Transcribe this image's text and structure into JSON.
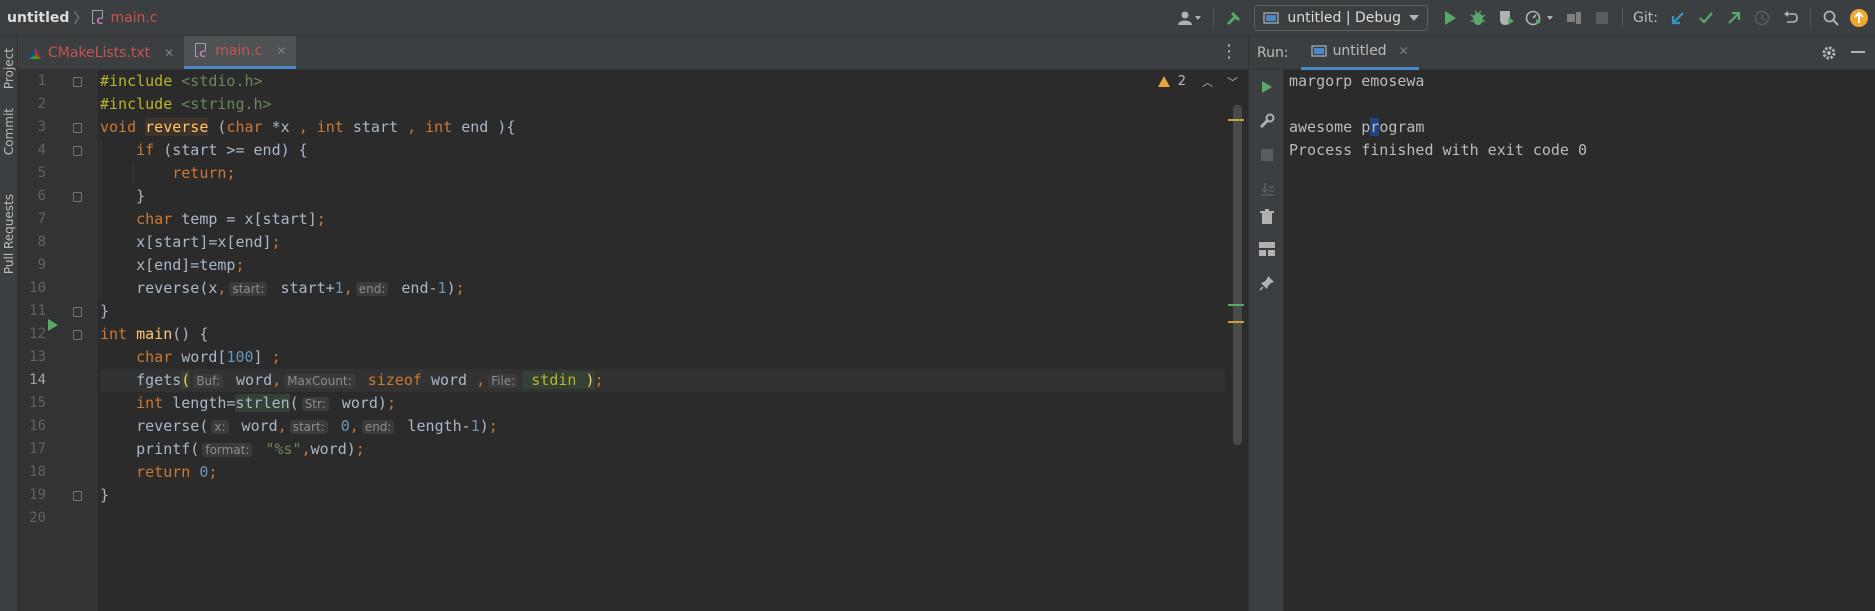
{
  "breadcrumb": {
    "project": "untitled",
    "file": "main.c"
  },
  "toolbar": {
    "run_config": "untitled | Debug",
    "git_label": "Git:"
  },
  "left_strip": {
    "tabs": [
      "Project",
      "Commit",
      "Pull Requests"
    ]
  },
  "editor_tabs": [
    {
      "label": "CMakeLists.txt",
      "active": false
    },
    {
      "label": "main.c",
      "active": true
    }
  ],
  "inspection": {
    "warning_count": "2"
  },
  "editor": {
    "current_line": 14,
    "lines": [
      {
        "n": "1"
      },
      {
        "n": "2"
      },
      {
        "n": "3"
      },
      {
        "n": "4"
      },
      {
        "n": "5"
      },
      {
        "n": "6"
      },
      {
        "n": "7"
      },
      {
        "n": "8"
      },
      {
        "n": "9"
      },
      {
        "n": "10"
      },
      {
        "n": "11"
      },
      {
        "n": "12"
      },
      {
        "n": "13"
      },
      {
        "n": "14"
      },
      {
        "n": "15"
      },
      {
        "n": "16"
      },
      {
        "n": "17"
      },
      {
        "n": "18"
      },
      {
        "n": "19"
      },
      {
        "n": "20"
      }
    ],
    "code": {
      "l1a": "#include ",
      "l1b": "<stdio.h>",
      "l2a": "#include ",
      "l2b": "<string.h>",
      "l3_kw": "void ",
      "l3_fn": "reverse",
      "l3_rest1": " (",
      "l3_char": "char ",
      "l3_rest2": "*x ",
      "l3_comma1": ", ",
      "l3_int1": "int ",
      "l3_rest3": "start ",
      "l3_comma2": ", ",
      "l3_int2": "int ",
      "l3_rest4": "end ){",
      "l4_if": "if ",
      "l4_rest": "(start >= end) {",
      "l5_ret": "return",
      "l5_semi": ";",
      "l6": "}",
      "l7_char": "char ",
      "l7_rest": "temp = x[start]",
      "l7_semi": ";",
      "l8_rest": "x[start]=x[end]",
      "l8_semi": ";",
      "l9_rest": "x[end]=temp",
      "l9_semi": ";",
      "l10_a": "reverse(x",
      "l10_c1": ",",
      "l10_h1": "start:",
      "l10_b": " start+",
      "l10_n1": "1",
      "l10_c2": ",",
      "l10_h2": "end:",
      "l10_d": " end-",
      "l10_n2": "1",
      "l10_e": ")",
      "l10_semi": ";",
      "l11": "}",
      "l12_int": "int ",
      "l12_fn": "main",
      "l12_rest": "() {",
      "l13_char": "char ",
      "l13_rest": "word[",
      "l13_num": "100",
      "l13_rest2": "] ",
      "l13_semi": ";",
      "l14_a": "fgets",
      "l14_paren": "(",
      "l14_h1": "Buf:",
      "l14_b": " word",
      "l14_c1": ",",
      "l14_h2": "MaxCount:",
      "l14_sizeof": " sizeof ",
      "l14_c": "word ",
      "l14_c2": ",",
      "l14_h3": "File:",
      "l14_stdin": " stdin ",
      "l14_close": ")",
      "l14_semi": ";",
      "l15_int": "int ",
      "l15_a": "length=",
      "l15_fn": "strlen",
      "l15_b": "(",
      "l15_h1": "Str:",
      "l15_c": " word)",
      "l15_semi": ";",
      "l16_a": "reverse(",
      "l16_h1": "x:",
      "l16_b": " word",
      "l16_c1": ",",
      "l16_h2": "start:",
      "l16_n1": " 0",
      "l16_c2": ",",
      "l16_h3": "end:",
      "l16_c": " length-",
      "l16_n2": "1",
      "l16_d": ")",
      "l16_semi": ";",
      "l17_a": "printf(",
      "l17_h1": "format:",
      "l17_str": " \"%s\"",
      "l17_c1": ",",
      "l17_b": "word)",
      "l17_semi": ";",
      "l18_ret": "return ",
      "l18_num": "0",
      "l18_semi": ";",
      "l19": "}"
    }
  },
  "run_panel": {
    "label": "Run:",
    "tab": "untitled",
    "output": {
      "line1": "margorp emosewa",
      "line3a": "awesome p",
      "line3b": "r",
      "line3c": "ogram",
      "line4": "Process finished with exit code 0"
    }
  },
  "colors": {
    "keyword": "#cc7832",
    "function": "#ffc66d",
    "string": "#6a8759",
    "number": "#6897bb",
    "accent": "#4a88c7",
    "run_green": "#59a869",
    "warning": "#e8a33d"
  }
}
